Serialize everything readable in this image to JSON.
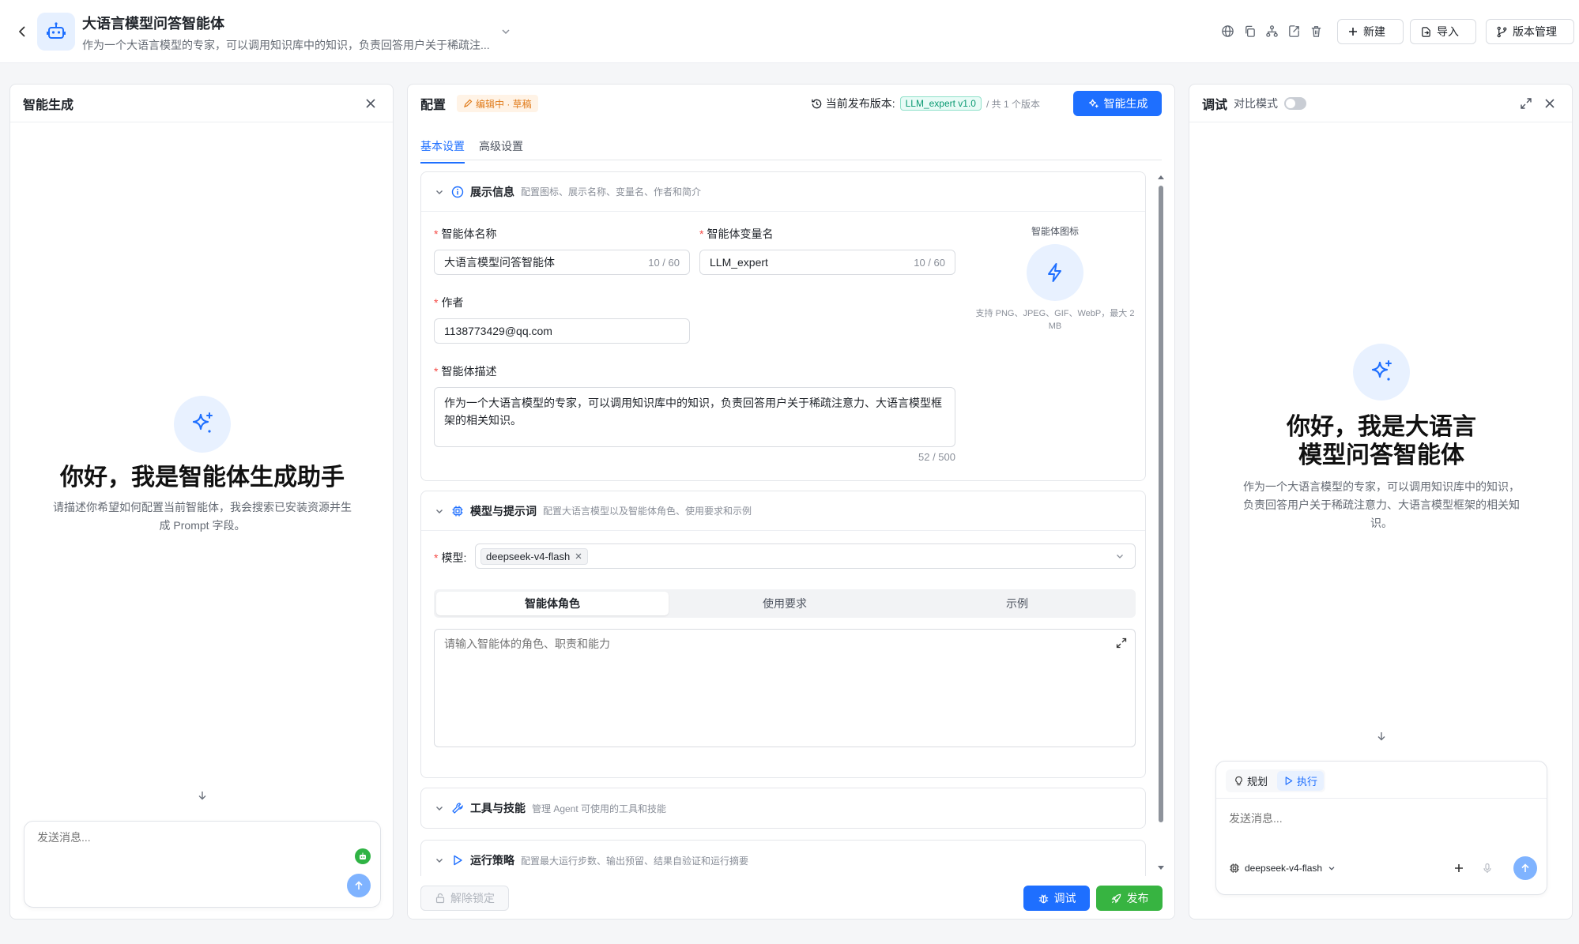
{
  "header": {
    "title": "大语言模型问答智能体",
    "description": "作为一个大语言模型的专家，可以调用知识库中的知识，负责回答用户关于稀疏注...",
    "buttons": {
      "new": "新建",
      "import": "导入",
      "version": "版本管理"
    },
    "icons": [
      "globe-icon",
      "copy-icon",
      "hierarchy-icon",
      "export-icon",
      "trash-icon"
    ]
  },
  "left_panel": {
    "title": "智能生成",
    "welcome_title": "你好，我是智能体生成助手",
    "welcome_sub": "请描述你希望如何配置当前智能体，我会搜索已安装资源并生成 Prompt 字段。",
    "input_placeholder": "发送消息..."
  },
  "config_panel": {
    "title": "配置",
    "status_tag": "编辑中 · 草稿",
    "version_label": "当前发布版本:",
    "version_tag": "LLM_expert v1.0",
    "version_count": "/ 共 1 个版本",
    "generate_button": "智能生成",
    "tabs": [
      {
        "label": "基本设置"
      },
      {
        "label": "高级设置"
      }
    ],
    "display_section": {
      "title": "展示信息",
      "subtitle": "配置图标、展示名称、变量名、作者和简介",
      "name_label": "智能体名称",
      "name_value": "大语言模型问答智能体",
      "name_count": "10 / 60",
      "var_label": "智能体变量名",
      "var_value": "LLM_expert",
      "var_count": "10 / 60",
      "icon_label": "智能体图标",
      "icon_hint": "支持 PNG、JPEG、GIF、WebP，最大 2 MB",
      "author_label": "作者",
      "author_value": "1138773429@qq.com",
      "desc_label": "智能体描述",
      "desc_value": "作为一个大语言模型的专家，可以调用知识库中的知识，负责回答用户关于稀疏注意力、大语言模型框架的相关知识。",
      "desc_count": "52 / 500"
    },
    "model_section": {
      "title": "模型与提示词",
      "subtitle": "配置大语言模型以及智能体角色、使用要求和示例",
      "model_label": "模型:",
      "model_value": "deepseek-v4-flash",
      "segments": [
        {
          "label": "智能体角色"
        },
        {
          "label": "使用要求"
        },
        {
          "label": "示例"
        }
      ],
      "prompt_placeholder": "请输入智能体的角色、职责和能力"
    },
    "tools_section": {
      "title": "工具与技能",
      "subtitle": "管理 Agent 可使用的工具和技能"
    },
    "policy_section": {
      "title": "运行策略",
      "subtitle": "配置最大运行步数、输出预留、结果自验证和运行摘要"
    },
    "unlock_button": "解除锁定",
    "debug_button": "调试",
    "publish_button": "发布"
  },
  "debug_panel": {
    "title": "调试",
    "compare_label": "对比模式",
    "welcome_title_1": "你好，我是大语言",
    "welcome_title_2": "模型问答智能体",
    "welcome_sub": "作为一个大语言模型的专家，可以调用知识库中的知识，负责回答用户关于稀疏注意力、大语言模型框架的相关知识。",
    "mode_plan": "规划",
    "mode_exec": "执行",
    "input_placeholder": "发送消息...",
    "model": "deepseek-v4-flash"
  },
  "colors": {
    "accent": "#1e6fff",
    "success": "#37b441",
    "warning": "#e07b1a"
  }
}
